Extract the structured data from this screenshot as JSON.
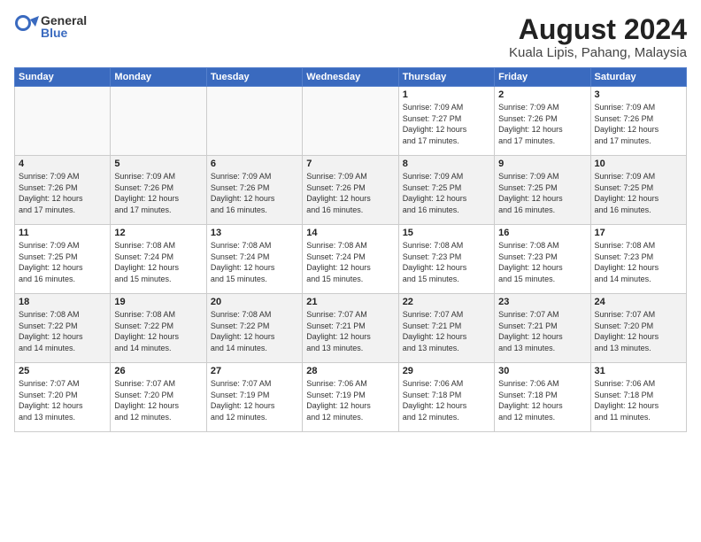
{
  "logo": {
    "general": "General",
    "blue": "Blue"
  },
  "header": {
    "month_year": "August 2024",
    "location": "Kuala Lipis, Pahang, Malaysia"
  },
  "weekdays": [
    "Sunday",
    "Monday",
    "Tuesday",
    "Wednesday",
    "Thursday",
    "Friday",
    "Saturday"
  ],
  "weeks": [
    [
      {
        "day": "",
        "info": ""
      },
      {
        "day": "",
        "info": ""
      },
      {
        "day": "",
        "info": ""
      },
      {
        "day": "",
        "info": ""
      },
      {
        "day": "1",
        "info": "Sunrise: 7:09 AM\nSunset: 7:27 PM\nDaylight: 12 hours\nand 17 minutes."
      },
      {
        "day": "2",
        "info": "Sunrise: 7:09 AM\nSunset: 7:26 PM\nDaylight: 12 hours\nand 17 minutes."
      },
      {
        "day": "3",
        "info": "Sunrise: 7:09 AM\nSunset: 7:26 PM\nDaylight: 12 hours\nand 17 minutes."
      }
    ],
    [
      {
        "day": "4",
        "info": "Sunrise: 7:09 AM\nSunset: 7:26 PM\nDaylight: 12 hours\nand 17 minutes."
      },
      {
        "day": "5",
        "info": "Sunrise: 7:09 AM\nSunset: 7:26 PM\nDaylight: 12 hours\nand 17 minutes."
      },
      {
        "day": "6",
        "info": "Sunrise: 7:09 AM\nSunset: 7:26 PM\nDaylight: 12 hours\nand 16 minutes."
      },
      {
        "day": "7",
        "info": "Sunrise: 7:09 AM\nSunset: 7:26 PM\nDaylight: 12 hours\nand 16 minutes."
      },
      {
        "day": "8",
        "info": "Sunrise: 7:09 AM\nSunset: 7:25 PM\nDaylight: 12 hours\nand 16 minutes."
      },
      {
        "day": "9",
        "info": "Sunrise: 7:09 AM\nSunset: 7:25 PM\nDaylight: 12 hours\nand 16 minutes."
      },
      {
        "day": "10",
        "info": "Sunrise: 7:09 AM\nSunset: 7:25 PM\nDaylight: 12 hours\nand 16 minutes."
      }
    ],
    [
      {
        "day": "11",
        "info": "Sunrise: 7:09 AM\nSunset: 7:25 PM\nDaylight: 12 hours\nand 16 minutes."
      },
      {
        "day": "12",
        "info": "Sunrise: 7:08 AM\nSunset: 7:24 PM\nDaylight: 12 hours\nand 15 minutes."
      },
      {
        "day": "13",
        "info": "Sunrise: 7:08 AM\nSunset: 7:24 PM\nDaylight: 12 hours\nand 15 minutes."
      },
      {
        "day": "14",
        "info": "Sunrise: 7:08 AM\nSunset: 7:24 PM\nDaylight: 12 hours\nand 15 minutes."
      },
      {
        "day": "15",
        "info": "Sunrise: 7:08 AM\nSunset: 7:23 PM\nDaylight: 12 hours\nand 15 minutes."
      },
      {
        "day": "16",
        "info": "Sunrise: 7:08 AM\nSunset: 7:23 PM\nDaylight: 12 hours\nand 15 minutes."
      },
      {
        "day": "17",
        "info": "Sunrise: 7:08 AM\nSunset: 7:23 PM\nDaylight: 12 hours\nand 14 minutes."
      }
    ],
    [
      {
        "day": "18",
        "info": "Sunrise: 7:08 AM\nSunset: 7:22 PM\nDaylight: 12 hours\nand 14 minutes."
      },
      {
        "day": "19",
        "info": "Sunrise: 7:08 AM\nSunset: 7:22 PM\nDaylight: 12 hours\nand 14 minutes."
      },
      {
        "day": "20",
        "info": "Sunrise: 7:08 AM\nSunset: 7:22 PM\nDaylight: 12 hours\nand 14 minutes."
      },
      {
        "day": "21",
        "info": "Sunrise: 7:07 AM\nSunset: 7:21 PM\nDaylight: 12 hours\nand 13 minutes."
      },
      {
        "day": "22",
        "info": "Sunrise: 7:07 AM\nSunset: 7:21 PM\nDaylight: 12 hours\nand 13 minutes."
      },
      {
        "day": "23",
        "info": "Sunrise: 7:07 AM\nSunset: 7:21 PM\nDaylight: 12 hours\nand 13 minutes."
      },
      {
        "day": "24",
        "info": "Sunrise: 7:07 AM\nSunset: 7:20 PM\nDaylight: 12 hours\nand 13 minutes."
      }
    ],
    [
      {
        "day": "25",
        "info": "Sunrise: 7:07 AM\nSunset: 7:20 PM\nDaylight: 12 hours\nand 13 minutes."
      },
      {
        "day": "26",
        "info": "Sunrise: 7:07 AM\nSunset: 7:20 PM\nDaylight: 12 hours\nand 12 minutes."
      },
      {
        "day": "27",
        "info": "Sunrise: 7:07 AM\nSunset: 7:19 PM\nDaylight: 12 hours\nand 12 minutes."
      },
      {
        "day": "28",
        "info": "Sunrise: 7:06 AM\nSunset: 7:19 PM\nDaylight: 12 hours\nand 12 minutes."
      },
      {
        "day": "29",
        "info": "Sunrise: 7:06 AM\nSunset: 7:18 PM\nDaylight: 12 hours\nand 12 minutes."
      },
      {
        "day": "30",
        "info": "Sunrise: 7:06 AM\nSunset: 7:18 PM\nDaylight: 12 hours\nand 12 minutes."
      },
      {
        "day": "31",
        "info": "Sunrise: 7:06 AM\nSunset: 7:18 PM\nDaylight: 12 hours\nand 11 minutes."
      }
    ]
  ]
}
